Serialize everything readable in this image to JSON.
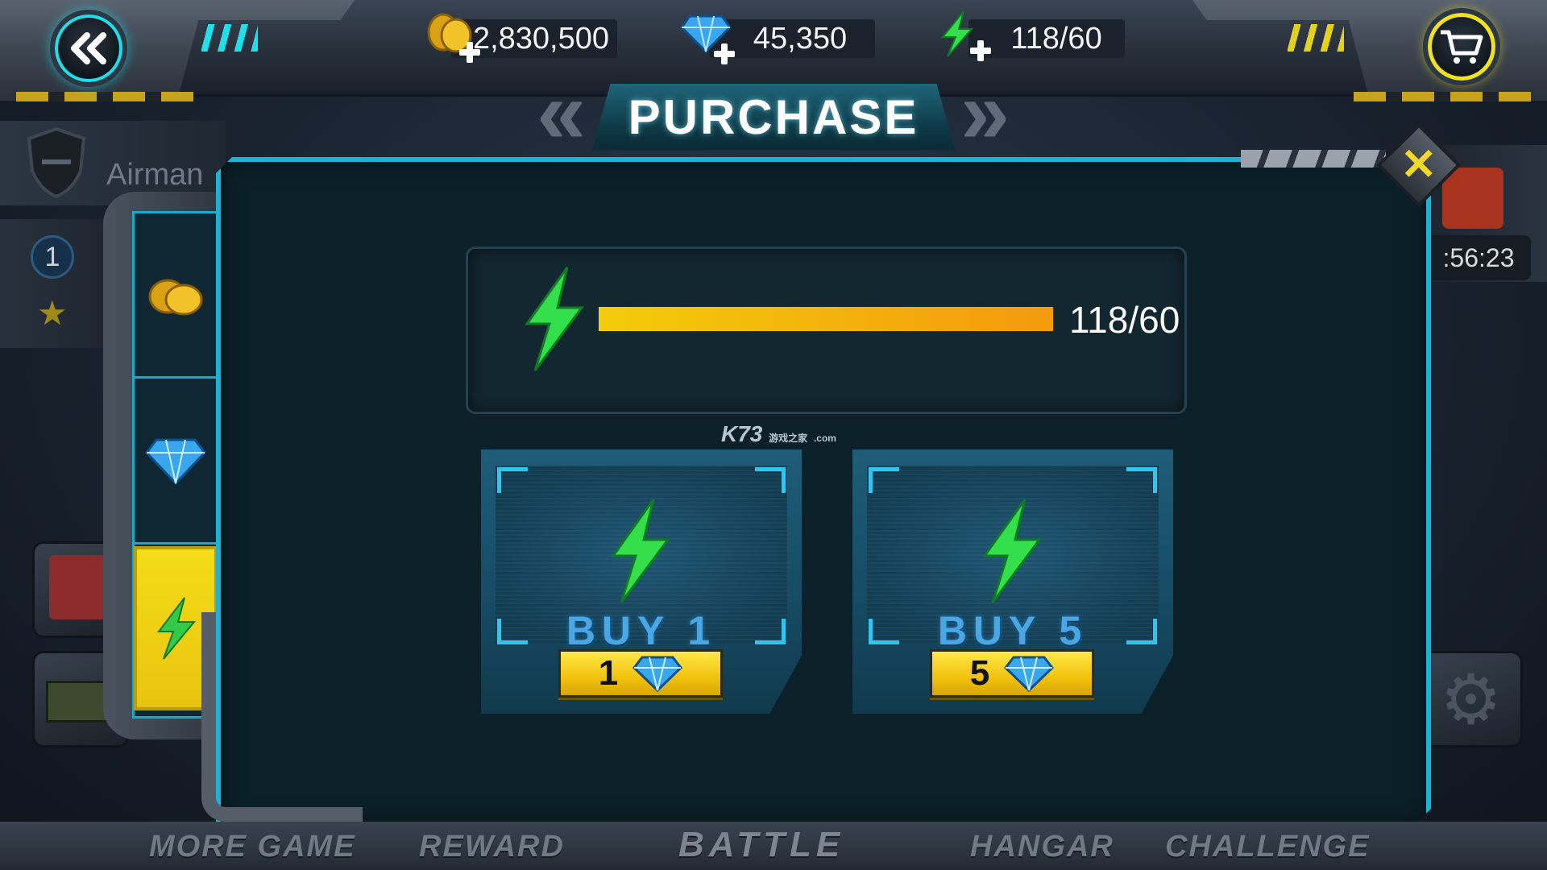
{
  "hud": {
    "coins": "2,830,500",
    "gems": "45,350",
    "energy": "118/60"
  },
  "background": {
    "player_name": "Airman",
    "rank": "1",
    "timer": ":56:23"
  },
  "dialog": {
    "title": "PURCHASE",
    "energy_readout": "118/60",
    "energy_fill": 1.0,
    "options": [
      {
        "label": "BUY 1",
        "price": "1"
      },
      {
        "label": "BUY 5",
        "price": "5"
      }
    ]
  },
  "watermark": {
    "main": "K73",
    "sub": "游戏之家",
    "domain": ".com"
  },
  "nav": {
    "more_game": "MORE GAME",
    "reward": "REWARD",
    "battle": "BATTLE",
    "hangar": "HANGAR",
    "challenge": "CHALLENGE"
  },
  "colors": {
    "accent_cyan": "#19b4d6",
    "energy_green": "#33e04b",
    "tab_active_yellow": "#f4dc18",
    "bar_start": "#f3cc0a",
    "bar_end": "#f49a0d",
    "gem_blue": "#39a6f0"
  },
  "icons": {
    "back": "double-chevron-left-icon",
    "cart": "shopping-cart-icon",
    "coins": "coins-icon",
    "gem": "diamond-icon",
    "energy": "lightning-bolt-icon",
    "close": "close-icon"
  }
}
